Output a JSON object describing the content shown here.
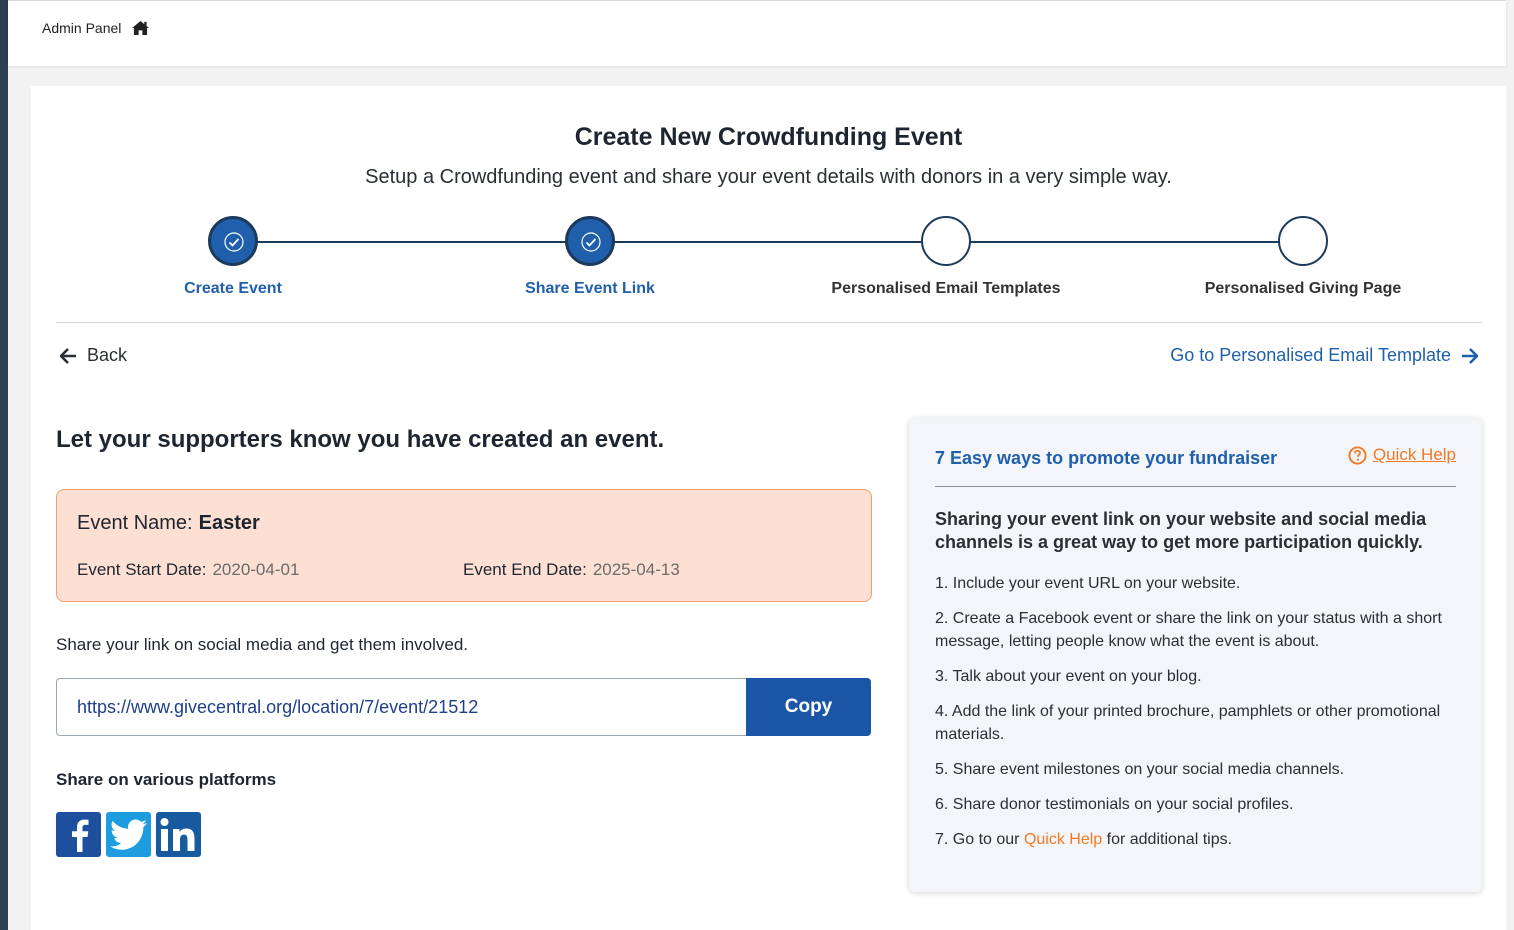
{
  "breadcrumb": {
    "label": "Admin Panel",
    "icon": "home-icon"
  },
  "header": {
    "title": "Create New Crowdfunding Event",
    "subtitle": "Setup a Crowdfunding event and share your event details with donors in a very simple way."
  },
  "steps": [
    {
      "label": "Create Event",
      "status": "done"
    },
    {
      "label": "Share Event Link",
      "status": "done"
    },
    {
      "label": "Personalised Email Templates",
      "status": "pending"
    },
    {
      "label": "Personalised Giving Page",
      "status": "pending"
    }
  ],
  "nav": {
    "back_label": "Back",
    "next_label": "Go to Personalised Email Template"
  },
  "main": {
    "heading": "Let your supporters know you have created an event.",
    "event": {
      "name_label": "Event Name:",
      "name_value": "Easter",
      "start_label": "Event Start Date:",
      "start_value": "2020-04-01",
      "end_label": "Event End Date:",
      "end_value": "2025-04-13"
    },
    "share_text": "Share your link on social media and get them involved.",
    "link_value": "https://www.givecentral.org/location/7/event/21512",
    "copy_label": "Copy",
    "platforms_label": "Share on various platforms",
    "platforms": [
      "facebook-icon",
      "twitter-icon",
      "linkedin-icon"
    ]
  },
  "help": {
    "title": "7 Easy ways to promote your fundraiser",
    "quick_help_label": "Quick Help",
    "lead": "Sharing your event link on your website and social media channels is a great way to get more participation quickly.",
    "items": [
      "1. Include your event URL on your website.",
      "2. Create a Facebook event or share the link on your status with a short message, letting people know what the event is about.",
      "3. Talk about your event on your blog.",
      "4. Add the link of your printed brochure, pamphlets or other promotional materials.",
      "5. Share event milestones on your social media channels.",
      "6. Share donor testimonials on your social profiles."
    ],
    "last_item": {
      "prefix": "7. Go to our ",
      "link": "Quick Help",
      "suffix": " for additional tips."
    }
  },
  "colors": {
    "primary": "#1f5fac",
    "accent": "#f07a26",
    "event_box_bg": "#fde0d3",
    "event_box_border": "#f0a173"
  }
}
